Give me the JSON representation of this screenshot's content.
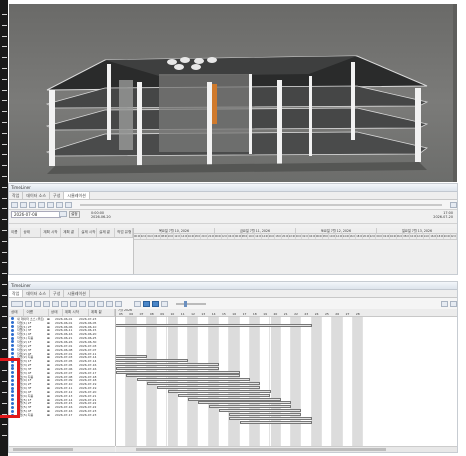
{
  "viewport": {},
  "timeline_top": {
    "title": "TimeLiner",
    "tabs": [
      "작업",
      "데이터 소스",
      "구성",
      "시뮬레이션"
    ],
    "active_tab": 3,
    "date_input": "2026-07-08",
    "date_button": "설정",
    "time_start_label": "0:00:00",
    "time_start_date": "2026-06-20",
    "time_end_label": "17:00",
    "time_end_date": "2026-07-20",
    "columns": [
      "이름",
      "상태",
      "계획 시작",
      "계획 끝",
      "실제 시작",
      "실제 끝",
      "작업 유형"
    ],
    "periods": [
      "목요일 7월 10, 2026",
      "금요일 7월 11, 2026",
      "토요일 7월 12, 2026",
      "일요일 7월 13, 2026"
    ],
    "hours": [
      "00:00",
      "02:00",
      "04:00",
      "06:00",
      "08:00",
      "10:00",
      "12:00",
      "14:00",
      "16:00",
      "18:00",
      "20:00",
      "22:00"
    ]
  },
  "timeline_bottom": {
    "title": "TimeLiner",
    "tabs": [
      "작업",
      "데이터 소스",
      "구성",
      "시뮬레이션"
    ],
    "active_tab": 0,
    "columns": [
      "상태",
      "이름",
      "상태",
      "계획 시작",
      "계획 끝"
    ],
    "month_label": "7월 2026",
    "days": [
      "05",
      "06",
      "07",
      "08",
      "09",
      "10",
      "11",
      "12",
      "13",
      "14",
      "15",
      "16",
      "17",
      "18",
      "19",
      "20",
      "21",
      "22",
      "23",
      "24",
      "25",
      "26",
      "27",
      "28"
    ],
    "tasks": [
      {
        "name": "새 데이터 소스 (루트)",
        "start": "2026-06-01",
        "end": "2026-07-23"
      },
      {
        "name": "작업(1) 1F",
        "start": "2026-06-01",
        "end": "2026-06-05"
      },
      {
        "name": "작업(1) 2F",
        "start": "2026-06-06",
        "end": "2026-06-10"
      },
      {
        "name": "작업(1) 3F",
        "start": "2026-06-11",
        "end": "2026-06-15"
      },
      {
        "name": "작업(1) 4F",
        "start": "2026-06-16",
        "end": "2026-06-20"
      },
      {
        "name": "작업(1) 지붕",
        "start": "2026-06-21",
        "end": "2026-06-25"
      },
      {
        "name": "작업(2) 1F",
        "start": "2026-06-26",
        "end": "2026-06-30"
      },
      {
        "name": "작업(2) 2F",
        "start": "2026-07-01",
        "end": "2026-07-03"
      },
      {
        "name": "작업(2) 3F",
        "start": "2026-06-08",
        "end": "2026-07-07"
      },
      {
        "name": "작업(2) 4F",
        "start": "2026-07-01",
        "end": "2026-07-11"
      },
      {
        "name": "작업(2) 지붕",
        "start": "2026-07-03",
        "end": "2026-07-14"
      },
      {
        "name": "작업(3) 1F",
        "start": "2026-07-05",
        "end": "2026-07-14"
      },
      {
        "name": "작업(3) 2F",
        "start": "2026-07-05",
        "end": "2026-07-16"
      },
      {
        "name": "작업(3) 3F",
        "start": "2026-07-06",
        "end": "2026-07-16"
      },
      {
        "name": "작업(3) 4F",
        "start": "2026-07-07",
        "end": "2026-07-17"
      },
      {
        "name": "작업(3) 지붕",
        "start": "2026-07-08",
        "end": "2026-07-18"
      },
      {
        "name": "작업(4) 1F",
        "start": "2026-07-09",
        "end": "2026-07-18"
      },
      {
        "name": "작업(4) 2F",
        "start": "2026-07-10",
        "end": "2026-07-19"
      },
      {
        "name": "작업(4) 3F",
        "start": "2026-07-11",
        "end": "2026-07-19"
      },
      {
        "name": "작업(4) 4F",
        "start": "2026-07-12",
        "end": "2026-07-20"
      },
      {
        "name": "작업(4) 지붕",
        "start": "2026-07-13",
        "end": "2026-07-21"
      },
      {
        "name": "작업(5) 1F",
        "start": "2026-07-14",
        "end": "2026-07-21"
      },
      {
        "name": "작업(5) 2F",
        "start": "2026-07-15",
        "end": "2026-07-22"
      },
      {
        "name": "작업(5) 3F",
        "start": "2026-07-16",
        "end": "2026-07-22"
      },
      {
        "name": "작업(5) 4F",
        "start": "2026-07-16",
        "end": "2026-07-23"
      },
      {
        "name": "작업(5) 지붕",
        "start": "2026-07-17",
        "end": "2026-07-23"
      }
    ]
  }
}
